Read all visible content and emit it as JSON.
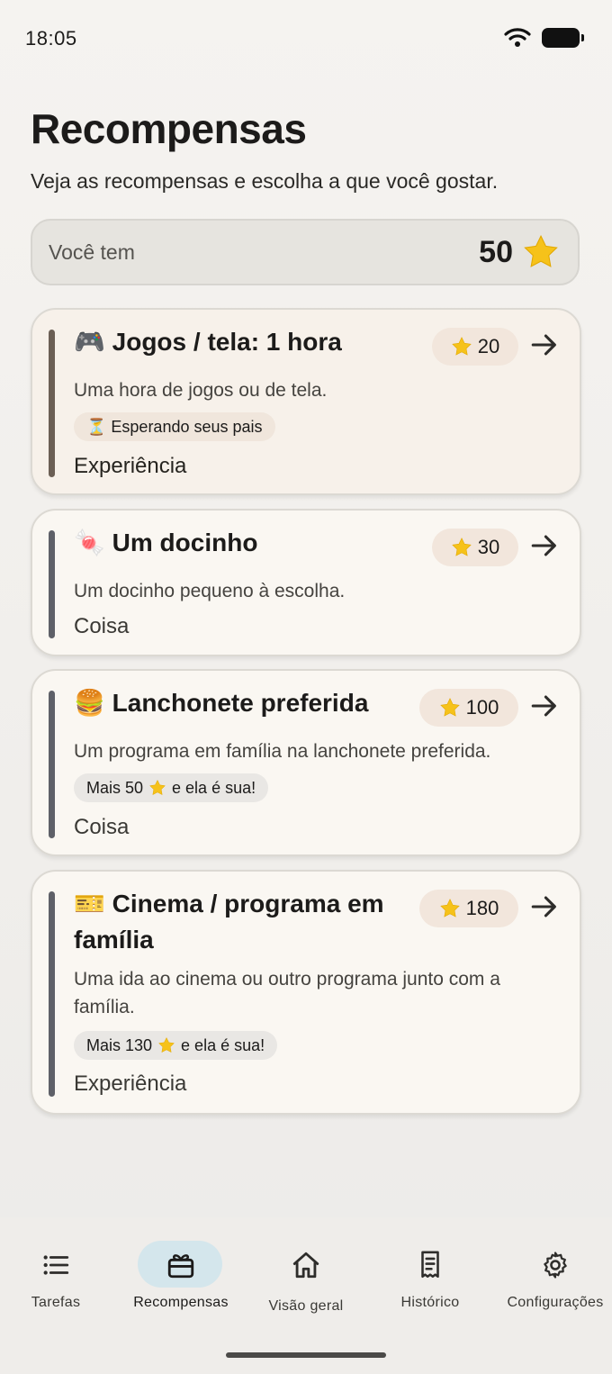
{
  "status_bar": {
    "time": "18:05"
  },
  "header": {
    "title": "Recompensas",
    "subtitle": "Veja as recompensas e escolha a que você gostar."
  },
  "balance": {
    "label": "Você tem",
    "value": "50",
    "icon": "star-icon"
  },
  "rewards": [
    {
      "emoji": "🎮",
      "title": "Jogos / tela: 1 hora",
      "cost": "20",
      "description": "Uma hora de jogos ou de tela.",
      "chip": "⏳ Esperando seus pais",
      "category": "Experiência"
    },
    {
      "emoji": "🍬",
      "title": "Um docinho",
      "cost": "30",
      "description": "Um docinho pequeno à escolha.",
      "category": "Coisa"
    },
    {
      "emoji": "🍔",
      "title": "Lanchonete preferida",
      "cost": "100",
      "description": "Um programa em família na lanchonete preferida.",
      "chip_prefix": "Mais 50",
      "chip_suffix": "e ela é sua!",
      "category": "Coisa"
    },
    {
      "emoji": "🎫",
      "title_line1": "Cinema / programa em",
      "title_line2": "família",
      "cost": "180",
      "description_line1": "Uma ida ao cinema ou outro programa junto com a",
      "description_line2": "família.",
      "chip_prefix": "Mais 130",
      "chip_suffix": "e ela é sua!",
      "category": "Experiência"
    }
  ],
  "nav": [
    {
      "label": "Tarefas",
      "icon": "list-icon"
    },
    {
      "label": "Recompensas",
      "icon": "gift-icon",
      "active": true
    },
    {
      "label": "Visão geral",
      "icon": "home-icon"
    },
    {
      "label": "Histórico",
      "icon": "receipt-icon"
    },
    {
      "label": "Configurações",
      "icon": "gear-icon"
    }
  ],
  "colors": {
    "star": "#f6c21a",
    "active_nav_pill": "#d4e6ec",
    "card_bar": "#5e6068"
  }
}
